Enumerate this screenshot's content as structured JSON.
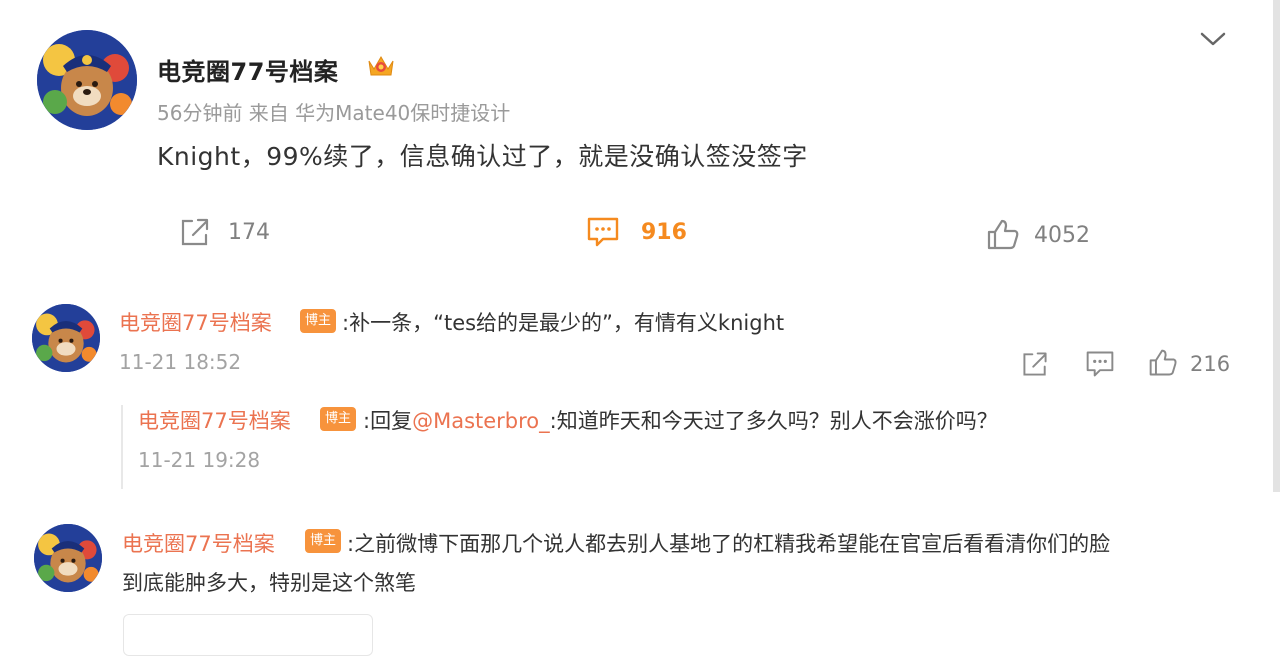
{
  "post": {
    "author": "电竞圈77号档案",
    "meta": "56分钟前  来自 华为Mate40保时捷设计",
    "text": "Knight，99%续了，信息确认过了，就是没确认签没签字",
    "share_count": "174",
    "comment_count": "916",
    "like_count": "4052"
  },
  "comments": [
    {
      "author": "电竞圈77号档案",
      "badge": "博主",
      "text": ":补一条，“tes给的是最少的”，有情有义knight",
      "time": "11-21 18:52",
      "like_count": "216",
      "reply": {
        "author": "电竞圈77号档案",
        "badge": "博主",
        "text_prefix": ":回复",
        "mention": "@Masterbro_",
        "text_suffix": ":知道昨天和今天过了多久吗？别人不会涨价吗？",
        "time": "11-21 19:28"
      }
    },
    {
      "author": "电竞圈77号档案",
      "badge": "博主",
      "text_line1": ":之前微博下面那几个说人都去别人基地了的杠精我希望能在官宣后看看清你们的脸",
      "text_line2": "到底能肿多大，特别是这个煞笔"
    }
  ],
  "colors": {
    "accent_orange": "#f58a1f",
    "username_link": "#eb7350",
    "badge_bg": "#f7933c",
    "meta_gray": "#9a9a9a"
  },
  "icons": [
    "share-icon",
    "comment-icon",
    "like-icon",
    "chevron-down-icon",
    "crown-icon"
  ]
}
